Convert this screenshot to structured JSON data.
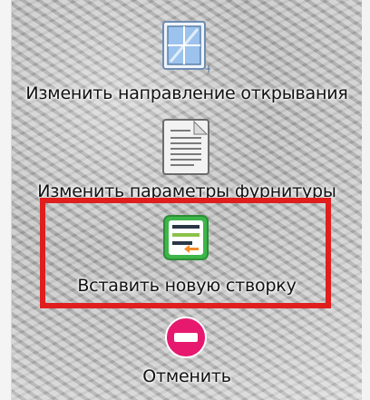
{
  "actions": [
    {
      "label": "Изменить направление открывания",
      "icon": "window-sash-icon"
    },
    {
      "label": "Изменить параметры фурнитуры",
      "icon": "document-icon"
    },
    {
      "label": "Вставить новую створку",
      "icon": "insert-sash-icon"
    },
    {
      "label": "Отменить",
      "icon": "cancel-icon"
    }
  ],
  "colors": {
    "highlight": "#e01e1e",
    "cancel": "#e6196f",
    "insert_icon_bg": "#3db64a"
  }
}
